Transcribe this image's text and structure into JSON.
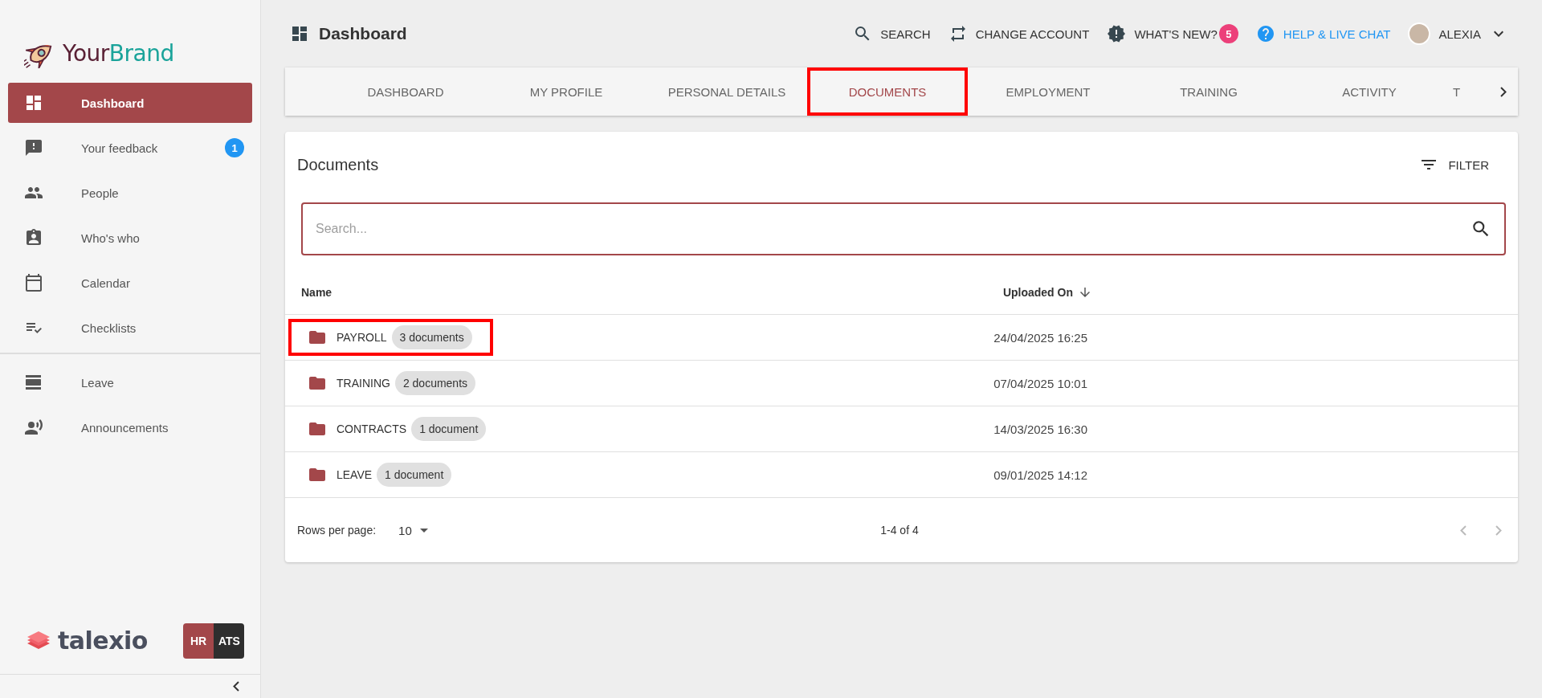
{
  "brand": {
    "first": "Your",
    "second": "Brand"
  },
  "sidebar": {
    "items": [
      {
        "label": "Dashboard",
        "selected": true
      },
      {
        "label": "Your feedback",
        "selected": false,
        "badge": "1"
      },
      {
        "label": "People",
        "selected": false
      },
      {
        "label": "Who's who",
        "selected": false
      },
      {
        "label": "Calendar",
        "selected": false
      },
      {
        "label": "Checklists",
        "selected": false
      }
    ],
    "secondary_items": [
      {
        "label": "Leave",
        "selected": false
      },
      {
        "label": "Announcements",
        "selected": false
      }
    ],
    "footer": {
      "logo_text": "talexio",
      "modules": [
        {
          "label": "HR",
          "selected": true
        },
        {
          "label": "ATS",
          "selected": false
        }
      ]
    }
  },
  "header": {
    "title": "Dashboard",
    "actions": [
      {
        "label": "SEARCH",
        "kind": "button"
      },
      {
        "label": "CHANGE ACCOUNT",
        "kind": "button"
      },
      {
        "label": "WHAT'S NEW?",
        "kind": "button",
        "badge": "5"
      },
      {
        "label": "HELP & LIVE CHAT",
        "kind": "link"
      }
    ],
    "user": {
      "name": "ALEXIA"
    }
  },
  "tabs": [
    {
      "label": "DASHBOARD",
      "selected": false,
      "highlighted": false
    },
    {
      "label": "MY PROFILE",
      "selected": false,
      "highlighted": false
    },
    {
      "label": "PERSONAL DETAILS",
      "selected": false,
      "highlighted": false
    },
    {
      "label": "DOCUMENTS",
      "selected": true,
      "highlighted": true
    },
    {
      "label": "EMPLOYMENT",
      "selected": false,
      "highlighted": false
    },
    {
      "label": "TRAINING",
      "selected": false,
      "highlighted": false
    },
    {
      "label": "ACTIVITY",
      "selected": false,
      "highlighted": false
    },
    {
      "label": "T",
      "selected": false,
      "highlighted": false
    }
  ],
  "documents": {
    "title": "Documents",
    "filter_label": "FILTER",
    "search": {
      "placeholder": "Search..."
    },
    "columns": [
      {
        "label": "Name",
        "sorted_descending": false
      },
      {
        "label": "Uploaded On",
        "sorted_descending": true
      }
    ],
    "rows": [
      {
        "name": "PAYROLL",
        "count": "3 documents",
        "uploaded_on": "24/04/2025 16:25",
        "highlighted": true
      },
      {
        "name": "TRAINING",
        "count": "2 documents",
        "uploaded_on": "07/04/2025 10:01",
        "highlighted": false
      },
      {
        "name": "CONTRACTS",
        "count": "1 document",
        "uploaded_on": "14/03/2025 16:30",
        "highlighted": false
      },
      {
        "name": "LEAVE",
        "count": "1 document",
        "uploaded_on": "09/01/2025 14:12",
        "highlighted": false
      }
    ],
    "pagination": {
      "rows_per_page_label": "Rows per page:",
      "rows_per_page": "10",
      "range": "1-4 of 4",
      "prev_disabled": true,
      "next_disabled": true
    }
  }
}
